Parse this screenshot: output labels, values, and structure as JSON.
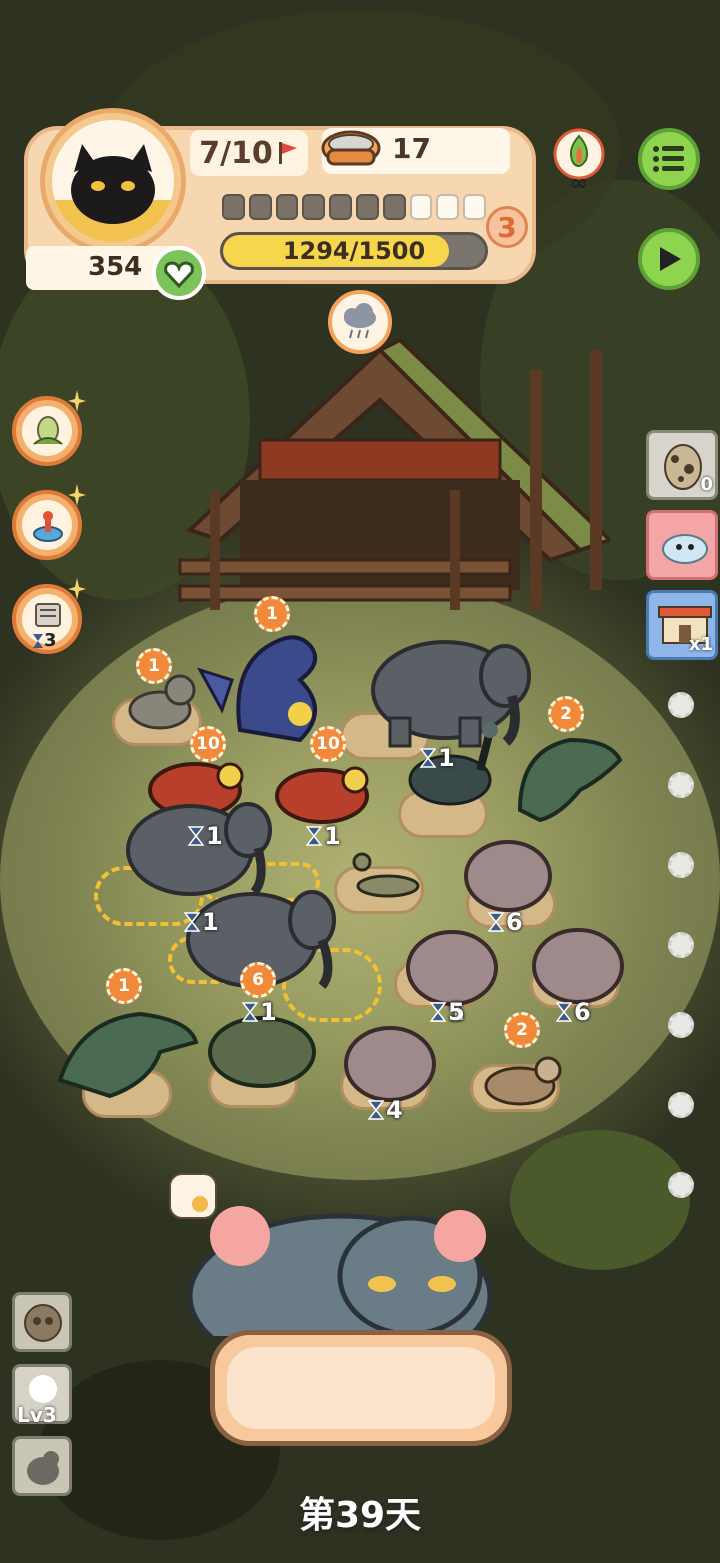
{
  "hud": {
    "level": "7/10",
    "food_count": "17",
    "stage_pips_total": 10,
    "stage_pips_filled": 3,
    "stage_number": "3",
    "xp_text": "1294/1500",
    "xp_fraction": 0.863,
    "heart_count": "354",
    "infinity": "∞"
  },
  "icons": {
    "menu": "menu-icon",
    "play": "play-icon",
    "weather": "rain-cloud-icon",
    "fire": "campfire-infinity-icon"
  },
  "side_left": {
    "items": [
      {
        "name": "seed-pod-icon",
        "badge": ""
      },
      {
        "name": "plunger-icon",
        "badge": ""
      },
      {
        "name": "scroll-icon",
        "badge": "3"
      }
    ]
  },
  "side_right": {
    "egg_count": "0",
    "shop_multiplier": "x1"
  },
  "board": {
    "timers": [
      "1",
      "1",
      "1",
      "1",
      "1",
      "6",
      "1",
      "5",
      "6",
      "4"
    ],
    "coins": [
      "1",
      "1",
      "10",
      "10",
      "2",
      "1",
      "6",
      "2"
    ]
  },
  "day_label": "第39天",
  "bottom": {
    "level_label": "Lv3"
  }
}
